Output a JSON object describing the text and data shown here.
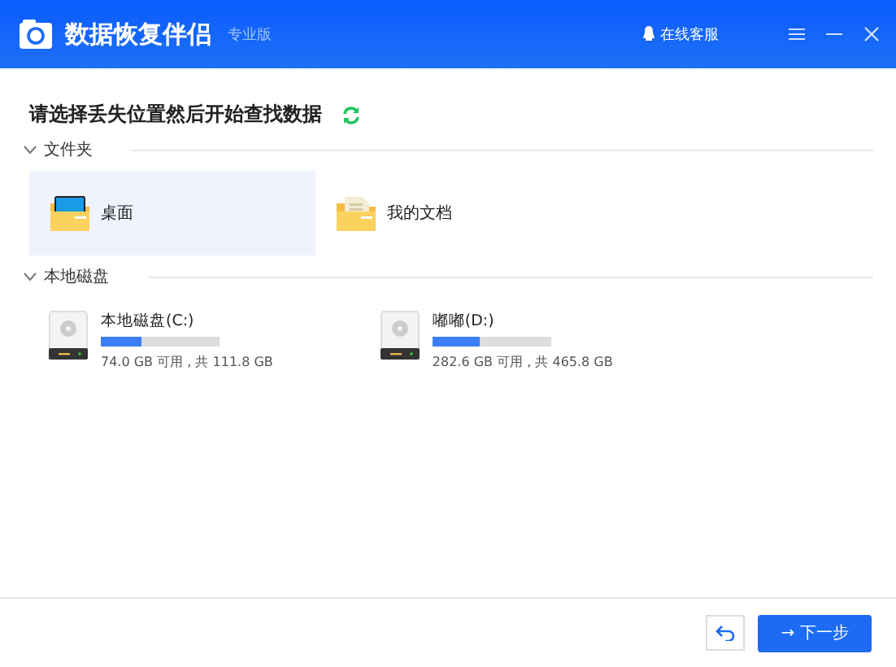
{
  "window": {
    "title": "数据恢复伴侣",
    "edition": "专业版",
    "support": "在线客服"
  },
  "prompt": "请选择丢失位置然后开始查找数据",
  "sections": [
    {
      "label": "文件夹",
      "expanded": true,
      "kind": "folders",
      "items": [
        {
          "name": "桌面",
          "selected": true,
          "kind": "desktop"
        },
        {
          "name": "我的文档",
          "selected": false,
          "kind": "documents"
        }
      ]
    },
    {
      "label": "本地磁盘",
      "expanded": true,
      "kind": "disks",
      "items": [
        {
          "name": "本地磁盘(C:)",
          "level": 0.34,
          "info": "74.0 GB 可用 , 共 111.8 GB"
        },
        {
          "name": "嘟嘟(D:)",
          "level": 0.4,
          "info": "282.6 GB 可用 , 共 465.8 GB"
        }
      ]
    }
  ],
  "footer": {
    "next_button": "→ 下一步"
  }
}
